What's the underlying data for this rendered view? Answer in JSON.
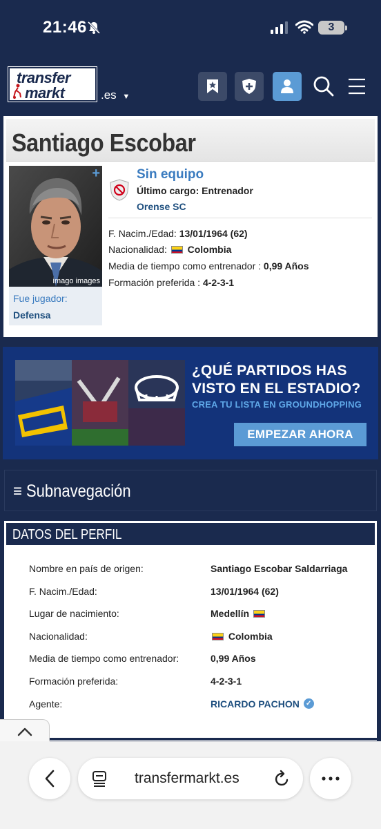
{
  "status_bar": {
    "time": "21:46",
    "battery": "3"
  },
  "header": {
    "logo_line1": "transfer",
    "logo_line2": "markt",
    "domain": ".es"
  },
  "profile": {
    "name": "Santiago Escobar",
    "photo_credit": "imago images",
    "photo_plus": "+",
    "fue_jugador_label": "Fue jugador:",
    "fue_jugador_value": "Defensa",
    "club_status": "Sin equipo",
    "last_role": "Último cargo: Entrenador",
    "last_club": "Orense SC",
    "birth_label": "F. Nacim./Edad:",
    "birth_value": "13/01/1964 (62)",
    "nationality_label": "Nacionalidad:",
    "nationality_value": "Colombia",
    "avg_time_label": "Media de tiempo como entrenador :",
    "avg_time_value": "0,99 Años",
    "formation_label": "Formación preferida :",
    "formation_value": "4-2-3-1"
  },
  "banner": {
    "headline_line1": "¿QUÉ PARTIDOS HAS",
    "headline_line2": "VISTO EN EL ESTADIO?",
    "subline": "CREA TU LISTA EN GROUNDHOPPING",
    "cta": "EMPEZAR AHORA"
  },
  "subnav": {
    "label": "≡ Subnavegación"
  },
  "datos": {
    "title": "DATOS DEL PERFIL",
    "rows": [
      {
        "label": "Nombre en país de origen:",
        "value": "Santiago Escobar Saldarriaga"
      },
      {
        "label": "F. Nacim./Edad:",
        "value": "13/01/1964 (62)"
      },
      {
        "label": "Lugar de nacimiento:",
        "value": "Medellín"
      },
      {
        "label": "Nacionalidad:",
        "value": "Colombia"
      },
      {
        "label": "Media de tiempo como entrenador:",
        "value": "0,99 Años"
      },
      {
        "label": "Formación preferida:",
        "value": "4-2-3-1"
      },
      {
        "label": "Agente:",
        "value": "RICARDO PACHON"
      }
    ]
  },
  "browser": {
    "url": "transfermarkt.es"
  },
  "colors": {
    "navy": "#1a2a4e",
    "accent_blue": "#5b9bd5",
    "link_blue": "#1d4e7e"
  }
}
